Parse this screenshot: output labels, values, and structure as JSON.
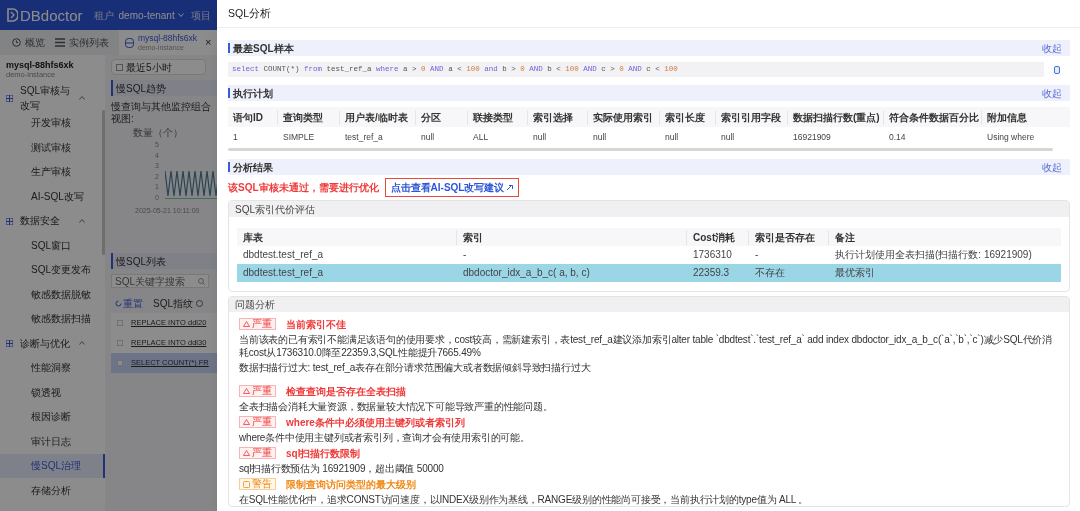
{
  "app_header": {
    "logo": "DBdoctor",
    "tenant_label": "租户",
    "tenant": "demo-tenant",
    "project_label": "项目"
  },
  "page_tabs": [
    {
      "kind": "overview",
      "label": "概览",
      "selected": false
    },
    {
      "kind": "list",
      "label": "实例列表",
      "selected": false
    },
    {
      "kind": "instance",
      "label": "mysql-88hfs6xk",
      "sublabel": "demo-instance",
      "close": "×",
      "selected": true
    }
  ],
  "sidebar": {
    "instance": "mysql-88hfs6xk",
    "instance_sub": "demo-instance",
    "groups": [
      {
        "label": "SQL审核与改写",
        "expanded": true,
        "items": [
          {
            "label": "开发审核",
            "selected": false
          },
          {
            "label": "测试审核",
            "selected": false
          },
          {
            "label": "生产审核",
            "selected": false
          },
          {
            "label": "AI-SQL改写",
            "selected": false
          }
        ]
      },
      {
        "label": "数据安全",
        "expanded": true,
        "items": [
          {
            "label": "SQL窗口",
            "selected": false
          },
          {
            "label": "SQL变更发布",
            "selected": false
          },
          {
            "label": "敏感数据脱敏",
            "selected": false
          },
          {
            "label": "敏感数据扫描",
            "selected": false
          }
        ]
      },
      {
        "label": "诊断与优化",
        "expanded": true,
        "items": [
          {
            "label": "性能洞察",
            "selected": false
          },
          {
            "label": "锁透视",
            "selected": false
          },
          {
            "label": "根因诊断",
            "selected": false
          },
          {
            "label": "审计日志",
            "selected": false
          },
          {
            "label": "慢SQL治理",
            "selected": true
          },
          {
            "label": "存储分析",
            "selected": false
          }
        ]
      }
    ]
  },
  "main": {
    "time_range": "最近5小时",
    "trend_title": "慢SQL趋势",
    "trend_subtitle": "慢查询与其他监控组合视图:",
    "chart_axis_title": "数量（个）",
    "chart_ticks": [
      "5",
      "4",
      "3",
      "2",
      "1",
      "0"
    ],
    "chart_time": "2025-05-21 10:11:00",
    "list_title": "慢SQL列表",
    "search_placeholder": "SQL关键字搜索",
    "reset": "重置",
    "column": "SQL指纹",
    "rows": [
      {
        "sql": "REPLACE INTO ddl20",
        "selected": false
      },
      {
        "sql": "REPLACE INTO ddl30",
        "selected": false
      },
      {
        "sql": "SELECT COUNT(*) FR",
        "selected": true
      }
    ]
  },
  "drawer": {
    "title": "SQL分析",
    "sample": {
      "title": "最差SQL样本",
      "collapse": "收起",
      "tokens": [
        {
          "text": "select",
          "kind": "keyword"
        },
        {
          "text": " COUNT(*) ",
          "kind": "plain"
        },
        {
          "text": "from",
          "kind": "keyword"
        },
        {
          "text": " test_ref_a ",
          "kind": "plain"
        },
        {
          "text": "where",
          "kind": "keyword"
        },
        {
          "text": " a > ",
          "kind": "plain"
        },
        {
          "text": "0 ",
          "kind": "number"
        },
        {
          "text": "AND",
          "kind": "keyword"
        },
        {
          "text": " a < ",
          "kind": "plain"
        },
        {
          "text": "100 ",
          "kind": "number"
        },
        {
          "text": "and",
          "kind": "keyword"
        },
        {
          "text": " b > ",
          "kind": "plain"
        },
        {
          "text": "0 ",
          "kind": "number"
        },
        {
          "text": "AND",
          "kind": "keyword"
        },
        {
          "text": " b < ",
          "kind": "plain"
        },
        {
          "text": "100 ",
          "kind": "number"
        },
        {
          "text": "AND",
          "kind": "keyword"
        },
        {
          "text": " c > ",
          "kind": "plain"
        },
        {
          "text": "0 ",
          "kind": "number"
        },
        {
          "text": "AND",
          "kind": "keyword"
        },
        {
          "text": " c < ",
          "kind": "plain"
        },
        {
          "text": "100",
          "kind": "number"
        }
      ]
    },
    "plan": {
      "title": "执行计划",
      "collapse": "收起",
      "columns": [
        "语句ID",
        "查询类型",
        "用户表/临时表",
        "分区",
        "联接类型",
        "索引选择",
        "实际使用索引",
        "索引长度",
        "索引引用字段",
        "数据扫描行数(重点)",
        "符合条件数据百分比",
        "附加信息"
      ],
      "rows": [
        [
          "1",
          "SIMPLE",
          "test_ref_a",
          "null",
          "ALL",
          "null",
          "null",
          "null",
          "null",
          "16921909",
          "0.14",
          "Using where"
        ]
      ]
    },
    "analysis": {
      "title": "分析结果",
      "collapse": "收起",
      "verdict": "该SQL审核未通过，需要进行优化",
      "ai_link": "点击查看AI-SQL改写建议",
      "cost_card": {
        "title": "SQL索引代价评估",
        "columns": [
          "库表",
          "索引",
          "Cost消耗",
          "索引是否存在",
          "备注"
        ],
        "rows": [
          {
            "cells": [
              "dbdtest.test_ref_a",
              "-",
              "1736310",
              "-",
              "执行计划使用全表扫描(扫描行数: 16921909)"
            ],
            "selected": false
          },
          {
            "cells": [
              "dbdtest.test_ref_a",
              "dbdoctor_idx_a_b_c( a, b, c)",
              "22359.3",
              "不存在",
              "最优索引"
            ],
            "selected": true
          }
        ]
      },
      "issues_card": {
        "title": "问题分析",
        "issues": [
          {
            "kind": "severe",
            "level": "严重",
            "title": "当前索引不佳",
            "lines": [
              "当前该表的已有索引不能满足该语句的使用要求，cost较高，需新建索引，表test_ref_a建议添加索引alter table `dbdtest`.`test_ref_a` add index dbdoctor_idx_a_b_c(`a`,`b`,`c`)减少SQL代价消耗cost从1736310.0降至22359.3,SQL性能提升7665.49%",
              "数据扫描行过大: test_ref_a表存在部分请求范围偏大或者数据倾斜导致扫描行过大"
            ]
          },
          {
            "kind": "severe",
            "level": "严重",
            "title": "检查查询是否存在全表扫描",
            "lines": [
              "全表扫描会消耗大量资源，数据量较大情况下可能导致严重的性能问题。"
            ]
          },
          {
            "kind": "severe",
            "level": "严重",
            "title": "where条件中必须使用主键列或者索引列",
            "lines": [
              "where条件中使用主键列或者索引列，查询才会有使用索引的可能。"
            ]
          },
          {
            "kind": "severe",
            "level": "严重",
            "title": "sql扫描行数限制",
            "lines": [
              "sql扫描行数预估为 16921909，超出阈值 50000"
            ]
          },
          {
            "kind": "warning",
            "level": "警告",
            "title": "限制查询访问类型的最大级别",
            "lines": [
              "在SQL性能优化中，追求CONST访问速度，以INDEX级别作为基线，RANGE级别的性能尚可接受，当前执行计划的type值为 ALL 。"
            ]
          }
        ]
      }
    }
  }
}
